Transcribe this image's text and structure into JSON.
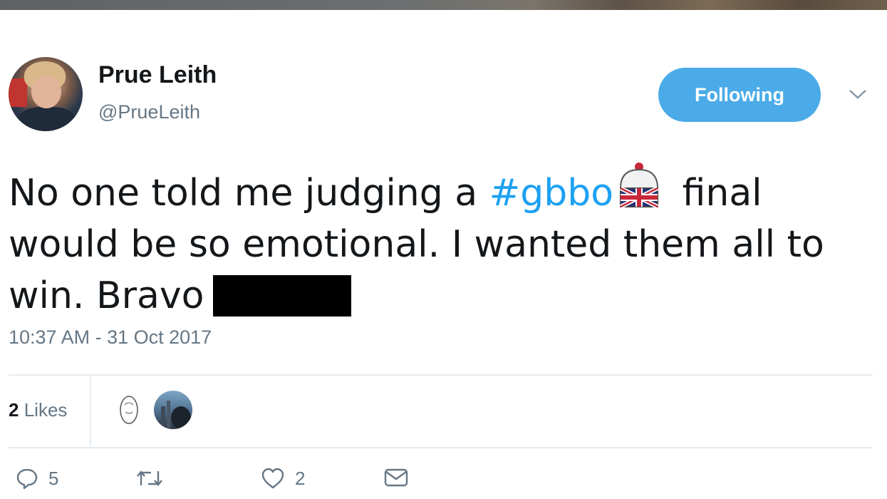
{
  "tweet": {
    "author_name": "Prue Leith",
    "author_handle": "@PrueLeith",
    "follow_label": "Following",
    "text_part1": "No one told me judging a ",
    "hashtag": "#gbbo",
    "text_part2": " final would be so emotional. I wanted them all to win. Bravo",
    "timestamp": "10:37 AM - 31 Oct 2017"
  },
  "stats": {
    "likes_number": "2",
    "likes_label": "Likes"
  },
  "actions": {
    "reply_count": "5",
    "retweet_count": "",
    "like_count": "2"
  },
  "icons": {
    "reply": "reply-icon",
    "retweet": "retweet-icon",
    "like": "heart-icon",
    "dm": "envelope-icon",
    "more": "chevron-down-icon",
    "emoji": "cake-union-jack-emoji"
  },
  "colors": {
    "accent": "#1da1f2",
    "follow_button": "#4aabe8",
    "muted_text": "#657786"
  }
}
